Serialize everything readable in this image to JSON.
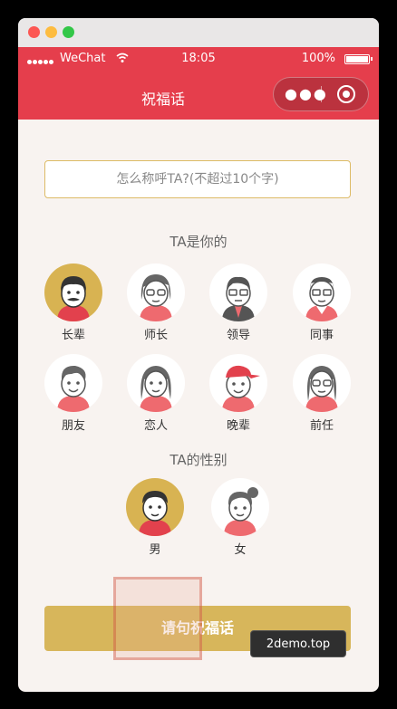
{
  "window": {
    "controls": [
      "close",
      "minimize",
      "zoom"
    ]
  },
  "status_bar": {
    "signal_dots": 5,
    "carrier": "WeChat",
    "time": "18:05",
    "battery": "100%",
    "battery_level": 1.0
  },
  "nav": {
    "title": "祝福话",
    "more_icon": "more-dots-icon",
    "close_icon": "close-circle-icon"
  },
  "name_input": {
    "placeholder": "怎么称呼TA?(不超过10个字)",
    "value": ""
  },
  "relation": {
    "title": "TA是你的",
    "items": [
      {
        "label": "长辈",
        "selected": true
      },
      {
        "label": "师长",
        "selected": false
      },
      {
        "label": "领导",
        "selected": false
      },
      {
        "label": "同事",
        "selected": false
      },
      {
        "label": "朋友",
        "selected": false
      },
      {
        "label": "恋人",
        "selected": false
      },
      {
        "label": "晚辈",
        "selected": false
      },
      {
        "label": "前任",
        "selected": false
      }
    ]
  },
  "gender": {
    "title": "TA的性别",
    "items": [
      {
        "label": "男",
        "selected": true
      },
      {
        "label": "女",
        "selected": false
      }
    ]
  },
  "submit": {
    "label": "请句祝福话"
  },
  "watermark": {
    "label": "2demo.top"
  },
  "colors": {
    "primary_red": "#e53e4c",
    "gold": "#d7b65b",
    "background": "#f8f3f0",
    "input_border": "#ddbb66"
  }
}
